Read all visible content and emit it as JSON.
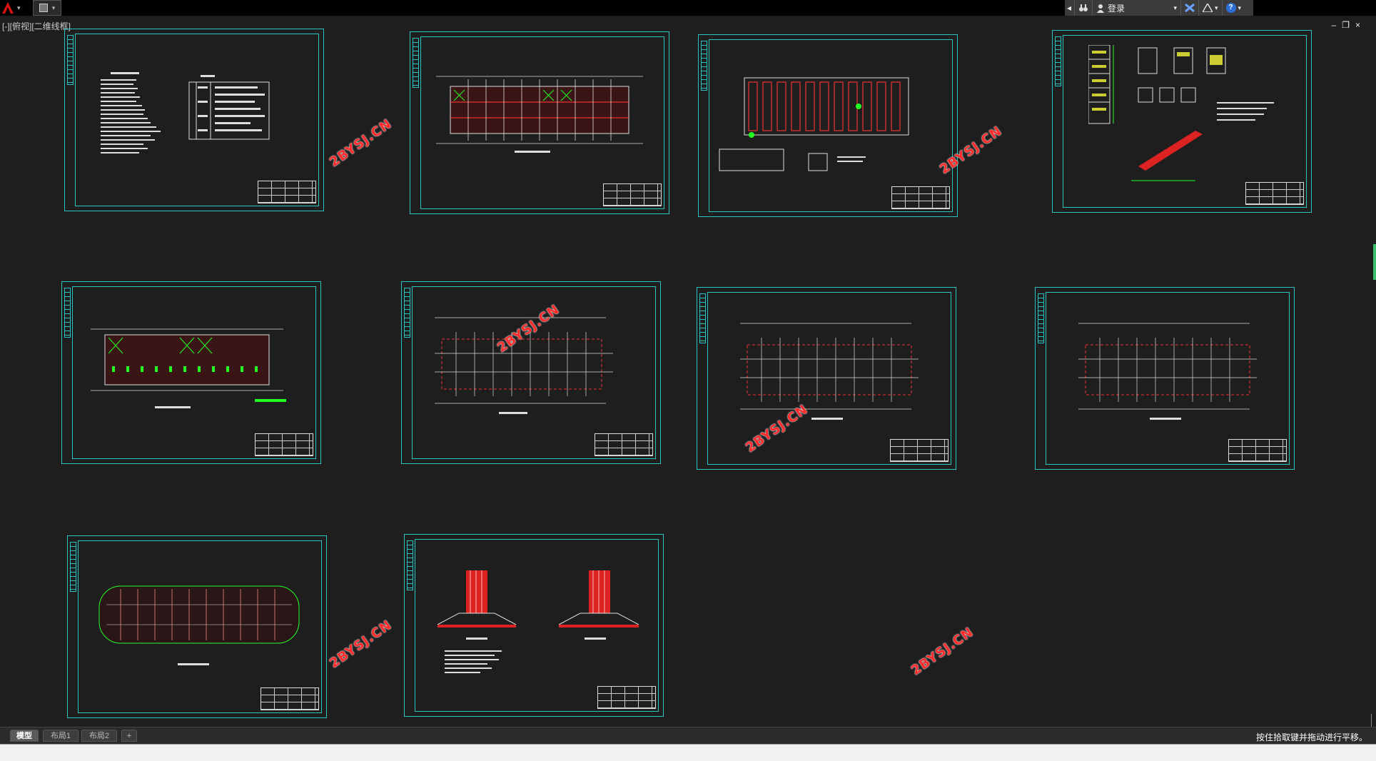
{
  "toolbar": {
    "app_icon": "autocad-a-icon",
    "qat_icon": "quick-access-icon"
  },
  "infocenter": {
    "search_icon": "binoculars-icon",
    "user_icon": "user-icon",
    "login_label": "登录",
    "exchange_icon": "x-exchange-icon",
    "stay_connected_icon": "stay-connected-icon",
    "help_icon": "help-icon",
    "help_glyph": "?"
  },
  "window_controls": {
    "minimize": "–",
    "restore": "❐",
    "close": "×"
  },
  "viewport": {
    "label": "[-][俯视][二维线框]",
    "frame_color": "#29c4c4",
    "watermark_text": "2BYSJ.CN"
  },
  "tabs": [
    {
      "label": "模型",
      "active": true
    },
    {
      "label": "布局1",
      "active": false
    },
    {
      "label": "布局2",
      "active": false
    },
    {
      "label": "+",
      "active": false
    }
  ],
  "status_message": "按住拾取键并拖动进行平移。"
}
